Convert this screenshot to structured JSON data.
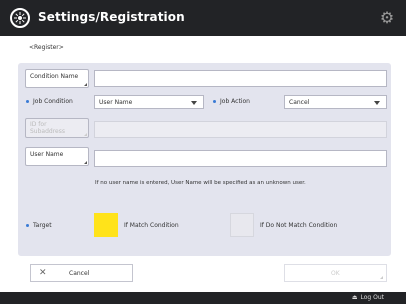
{
  "window": {
    "title": "Settings/Registration"
  },
  "breadcrumb": "<Register>",
  "form": {
    "condition_name": {
      "label": "Condition Name",
      "value": ""
    },
    "job_condition": {
      "label": "Job Condition",
      "selected": "User Name"
    },
    "job_action": {
      "label": "Job Action",
      "selected": "Cancel"
    },
    "id_subaddress": {
      "label": "ID for Subaddress",
      "value": ""
    },
    "user_name": {
      "label": "User Name",
      "value": ""
    },
    "note": "If no user name is entered, User Name will be specified as an unknown user.",
    "target": {
      "label": "Target",
      "if_match": {
        "label": "If Match Condition",
        "color": "#ffe31a"
      },
      "if_not_match": {
        "label": "If Do Not Match Condition",
        "color": "#e8e8ee"
      }
    }
  },
  "footer": {
    "cancel_label": "Cancel",
    "ok_label": "OK"
  },
  "status": {
    "logout_label": "Log Out"
  },
  "colors": {
    "accent": "#3a7bd5",
    "titlebar": "#222326",
    "panel": "#e3e4ee"
  }
}
